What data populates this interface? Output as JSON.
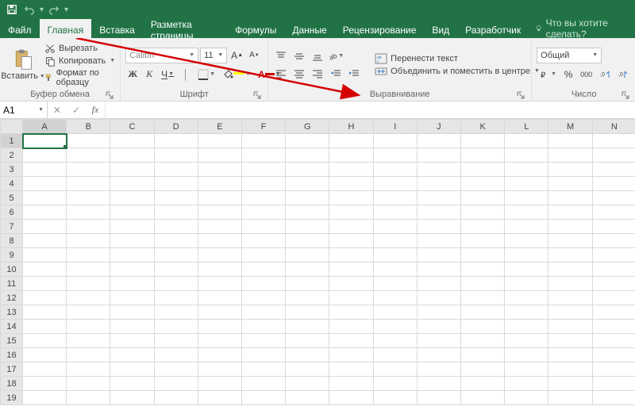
{
  "tabs": {
    "file": "Файл",
    "home": "Главная",
    "insert": "Вставка",
    "layout": "Разметка страницы",
    "formulas": "Формулы",
    "data": "Данные",
    "review": "Рецензирование",
    "view": "Вид",
    "developer": "Разработчик"
  },
  "tell_me": "Что вы хотите сделать?",
  "ribbon": {
    "paste": "Вставить",
    "cut": "Вырезать",
    "copy": "Копировать",
    "format_painter": "Формат по образцу",
    "clipboard_group": "Буфер обмена",
    "font_name": "Calibri",
    "font_size": "11",
    "bold": "Ж",
    "italic": "К",
    "underline": "Ч",
    "font_group": "Шрифт",
    "wrap_text": "Перенести текст",
    "merge_center": "Объединить и поместить в центре",
    "alignment_group": "Выравнивание",
    "number_format": "Общий",
    "number_group": "Число"
  },
  "namebox": "A1",
  "columns": [
    "A",
    "B",
    "C",
    "D",
    "E",
    "F",
    "G",
    "H",
    "I",
    "J",
    "K",
    "L",
    "M",
    "N"
  ],
  "rows": [
    "1",
    "2",
    "3",
    "4",
    "5",
    "6",
    "7",
    "8",
    "9",
    "10",
    "11",
    "12",
    "13",
    "14",
    "15",
    "16",
    "17",
    "18",
    "19"
  ],
  "selected_cell": "A1"
}
